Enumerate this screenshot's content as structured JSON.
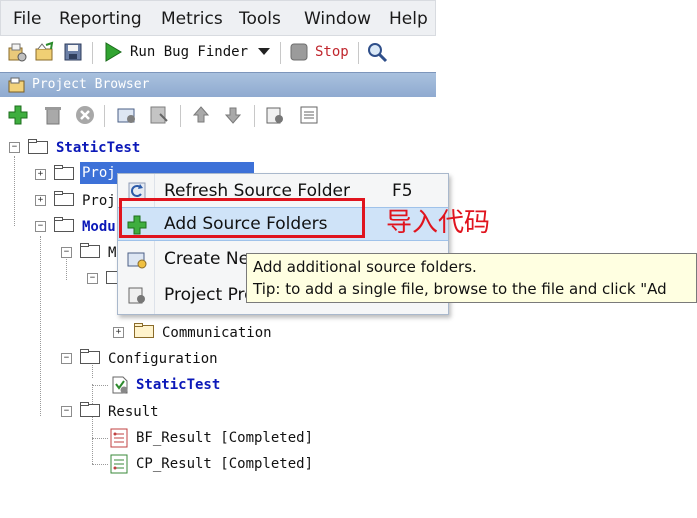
{
  "menubar": {
    "items": [
      "File",
      "Reporting",
      "Metrics",
      "Tools",
      "Window",
      "Help"
    ]
  },
  "toolbar": {
    "run_bug_finder_label": "Run Bug Finder",
    "stop_label": "Stop",
    "icons": [
      "new-project-icon",
      "open-project-icon",
      "save-icon",
      "run-icon",
      "dropdown-arrow-icon",
      "stop-icon",
      "search-icon"
    ]
  },
  "project_browser": {
    "title": "Project Browser",
    "toolbar_icons": [
      "add-icon",
      "delete-icon",
      "cancel-icon",
      "folder-settings-icon",
      "bookmark-icon",
      "move-up-icon",
      "move-down-icon",
      "properties-icon",
      "list-icon"
    ]
  },
  "tree": {
    "root": "StaticTest",
    "source_files_visible": "Proj",
    "proj_truncated": "Proj",
    "modules_visible": "Modu",
    "m_visible": "M",
    "communication": "Communication",
    "configuration": "Configuration",
    "config_static_test": "StaticTest",
    "result": "Result",
    "bf_result": "BF_Result [Completed]",
    "cp_result": "CP_Result [Completed]"
  },
  "context_menu": {
    "items": [
      {
        "label": "Refresh Source Folder",
        "shortcut": "F5",
        "icon": "refresh-icon"
      },
      {
        "label": "Add Source Folders",
        "shortcut": "",
        "icon": "add-icon"
      },
      {
        "label": "Create Ne",
        "shortcut": "",
        "icon": "new-module-icon"
      },
      {
        "label": "Project Pro",
        "shortcut": "",
        "icon": "properties-icon"
      }
    ]
  },
  "tooltip": {
    "line1": "Add additional source folders.",
    "line2": "Tip: to add a single file, browse to the file and click \"Ad"
  },
  "annotation": {
    "text": "导入代码",
    "color": "#e0141e"
  },
  "colors": {
    "selection": "#3d71d8",
    "tree_bold": "#0b18b8",
    "context_highlight": "#cfe3f8"
  }
}
